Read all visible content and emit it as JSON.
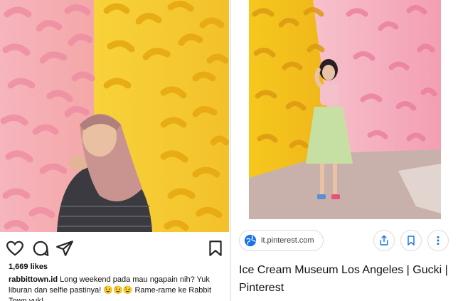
{
  "instagram": {
    "likes": "1,669 likes",
    "username": "rabbittown.id",
    "caption": "Long weekend pada mau ngapain nih? Yuk liburan dan selfie pastinya! 😉😉😉 Rame-rame ke Rabbit Town yuk!",
    "icons": {
      "like": "heart-icon",
      "comment": "comment-icon",
      "share": "share-icon",
      "save": "bookmark-icon"
    }
  },
  "pinterest": {
    "source_url": "it.pinterest.com",
    "title": "Ice Cream Museum Los Angeles | Gucki | Pinterest",
    "icons": {
      "source": "globe-icon",
      "share": "share-icon",
      "save": "bookmark-icon",
      "more": "more-icon"
    }
  },
  "colors": {
    "banana_yellow": "#f5c518",
    "banana_pink": "#f2a3b3",
    "floor": "#c9b3ad",
    "icon_dark": "#262626",
    "link_blue": "#1a73e8"
  }
}
